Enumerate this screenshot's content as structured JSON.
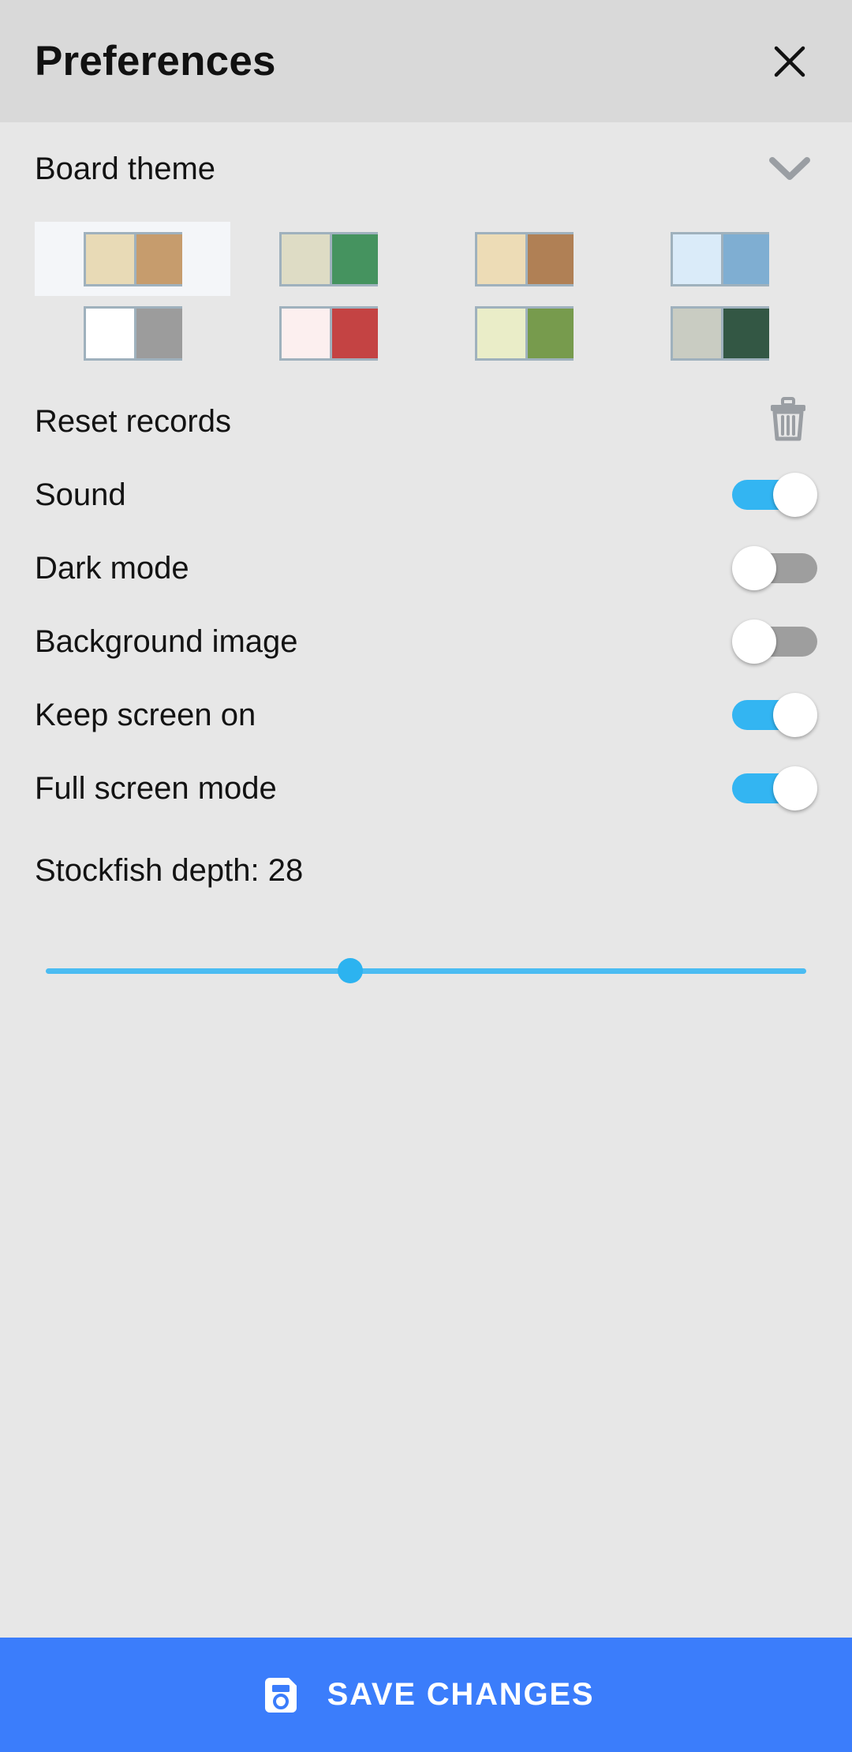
{
  "header": {
    "title": "Preferences",
    "close_icon": "close-icon"
  },
  "board_theme": {
    "label": "Board theme",
    "expand_icon": "chevron-down-icon",
    "selected_index": 0,
    "themes": [
      {
        "name": "classic-tan",
        "light": "#E8DAB6",
        "dark": "#C69C6D",
        "selected": true
      },
      {
        "name": "green",
        "light": "#DEDCC5",
        "dark": "#45935F",
        "selected": false
      },
      {
        "name": "wood-brown",
        "light": "#EDDCB6",
        "dark": "#B08055",
        "selected": false
      },
      {
        "name": "blue",
        "light": "#DAEBF9",
        "dark": "#7FAED2",
        "selected": false
      },
      {
        "name": "gray",
        "light": "#FFFFFF",
        "dark": "#9C9C9C",
        "selected": false
      },
      {
        "name": "red",
        "light": "#FCEFEF",
        "dark": "#C44343",
        "selected": false
      },
      {
        "name": "olive",
        "light": "#EAEDC8",
        "dark": "#779B4D",
        "selected": false
      },
      {
        "name": "forest",
        "light": "#C9CCC2",
        "dark": "#335744",
        "selected": false
      }
    ]
  },
  "settings": {
    "reset_records": {
      "label": "Reset records",
      "icon": "trash-icon"
    },
    "toggles": [
      {
        "name": "sound",
        "label": "Sound",
        "state": "on",
        "state_label": "ON"
      },
      {
        "name": "dark-mode",
        "label": "Dark mode",
        "state": "off",
        "state_label": "OFF"
      },
      {
        "name": "background-image",
        "label": "Background image",
        "state": "off",
        "state_label": "OFF"
      },
      {
        "name": "keep-screen-on",
        "label": "Keep screen on",
        "state": "on",
        "state_label": "ON"
      },
      {
        "name": "full-screen-mode",
        "label": "Full screen mode",
        "state": "on",
        "state_label": "ON"
      }
    ],
    "stockfish_depth": {
      "label": "Stockfish depth: 28",
      "value": 28,
      "percent": 40
    }
  },
  "save_bar": {
    "label": "SAVE CHANGES",
    "icon": "save-floppy-icon",
    "color": "#3b7dfb"
  },
  "colors": {
    "header_bg": "#d9d9d9",
    "body_bg": "#e7e7e7",
    "toggle_on": "#33b5f2",
    "toggle_off": "#9e9e9e",
    "slider": "#4bbcf2",
    "accent": "#3b7dfb",
    "swatch_border": "#9fb1bd",
    "selected_bg": "#f4f6f9"
  }
}
